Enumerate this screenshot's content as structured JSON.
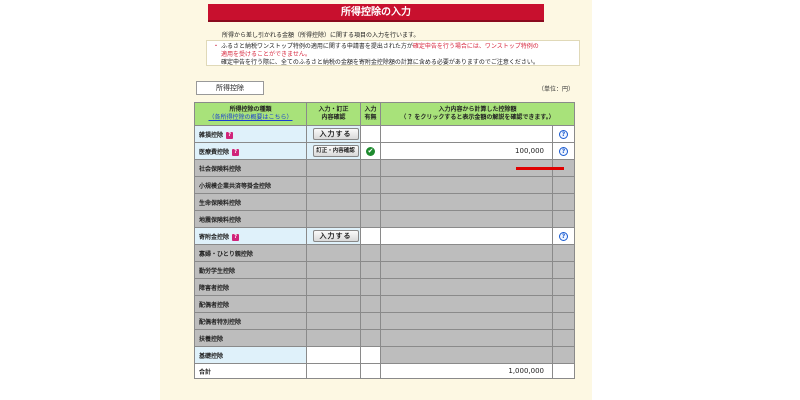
{
  "header": {
    "title": "所得控除の入力",
    "intro": "所得から差し引かれる金額（所得控除）に関する項目の入力を行います。"
  },
  "notes": {
    "bullet": "・",
    "line1_a": "ふるさと納税ワンストップ特例の適用に関する申請書を提出された方が",
    "line1_red": "確定申告を行う場合には、ワンストップ特例の",
    "line2_red": "適用を受けることができません。",
    "line3": "確定申告を行う際に、全てのふるさと納税の金額を寄附金控除額の計算に含める必要がありますのでご注意ください。"
  },
  "tab_label": "所得控除",
  "unit_label": "（単位：円）",
  "table": {
    "headers": {
      "type": "所得控除の種類",
      "type_link": "（各所得控除の概要はこちら）",
      "input": "入力・訂正",
      "input2": "内容確認",
      "status": "入力",
      "status2": "有無",
      "amount": "入力内容から計算した控除額",
      "amount2": "（ ？をクリックすると表示金額の解説を確認できます。）"
    },
    "rows": [
      {
        "name": "雑損控除",
        "help": true,
        "button": "入力する",
        "check": false,
        "amount": "",
        "gray": false
      },
      {
        "name": "医療費控除",
        "help": true,
        "button": "訂正・内容確認",
        "check": true,
        "amount": "100,000",
        "gray": false
      },
      {
        "name": "社会保険料控除",
        "help": false,
        "button": "",
        "check": false,
        "amount": "",
        "gray": true
      },
      {
        "name": "小規模企業共済等掛金控除",
        "help": false,
        "button": "",
        "check": false,
        "amount": "",
        "gray": true
      },
      {
        "name": "生命保険料控除",
        "help": false,
        "button": "",
        "check": false,
        "amount": "",
        "gray": true
      },
      {
        "name": "地震保険料控除",
        "help": false,
        "button": "",
        "check": false,
        "amount": "",
        "gray": true
      },
      {
        "name": "寄附金控除",
        "help": true,
        "button": "入力する",
        "check": false,
        "amount": "",
        "gray": false
      },
      {
        "name": "寡婦・ひとり親控除",
        "help": false,
        "button": "",
        "check": false,
        "amount": "",
        "gray": true
      },
      {
        "name": "勤労学生控除",
        "help": false,
        "button": "",
        "check": false,
        "amount": "",
        "gray": true
      },
      {
        "name": "障害者控除",
        "help": false,
        "button": "",
        "check": false,
        "amount": "",
        "gray": true
      },
      {
        "name": "配偶者控除",
        "help": false,
        "button": "",
        "check": false,
        "amount": "",
        "gray": true
      },
      {
        "name": "配偶者特別控除",
        "help": false,
        "button": "",
        "check": false,
        "amount": "",
        "gray": true
      },
      {
        "name": "扶養控除",
        "help": false,
        "button": "",
        "check": false,
        "amount": "",
        "gray": true
      }
    ],
    "basic_row": "基礎控除",
    "total_label": "合計",
    "total_amount": "1,000,000"
  },
  "icons": {
    "help": "?",
    "row_help": "?",
    "check": "✔"
  },
  "colors": {
    "title_bar": "#c8102e",
    "header_green": "#a8e27a",
    "row_blue": "#dff1fa",
    "disabled_gray": "#bdbdbd",
    "check_green": "#1e8a2e"
  }
}
